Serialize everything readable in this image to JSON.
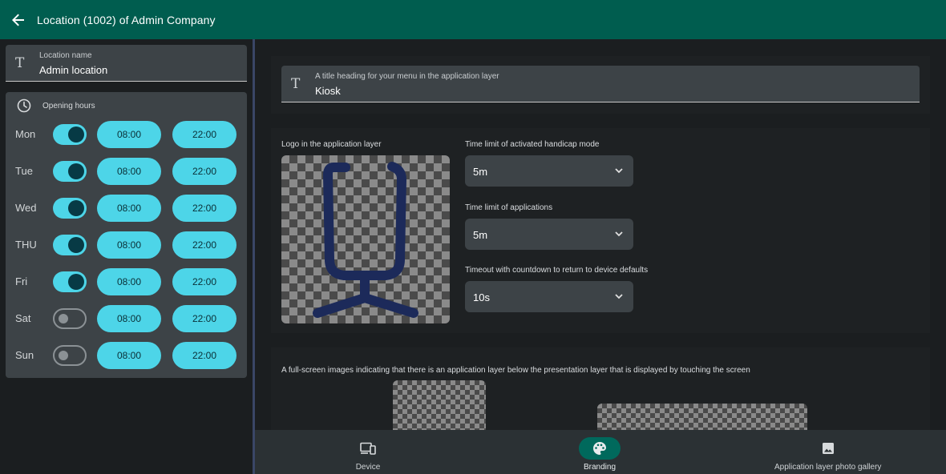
{
  "appbar": {
    "title": "Location (1002) of  Admin Company",
    "back_icon": "arrow-left-icon"
  },
  "location_name": {
    "label": "Location name",
    "value": "Admin location"
  },
  "opening_hours": {
    "label": "Opening hours",
    "days": [
      {
        "day": "Mon",
        "enabled": true,
        "start": "08:00",
        "end": "22:00"
      },
      {
        "day": "Tue",
        "enabled": true,
        "start": "08:00",
        "end": "22:00"
      },
      {
        "day": "Wed",
        "enabled": true,
        "start": "08:00",
        "end": "22:00"
      },
      {
        "day": "THU",
        "enabled": true,
        "start": "08:00",
        "end": "22:00"
      },
      {
        "day": "Fri",
        "enabled": true,
        "start": "08:00",
        "end": "22:00"
      },
      {
        "day": "Sat",
        "enabled": false,
        "start": "08:00",
        "end": "22:00"
      },
      {
        "day": "Sun",
        "enabled": false,
        "start": "08:00",
        "end": "22:00"
      }
    ]
  },
  "menu_title": {
    "label": "A title heading for your menu in the application layer",
    "value": "Kiosk"
  },
  "logo": {
    "label": "Logo in the application layer"
  },
  "handicap_limit": {
    "label": "Time limit of activated handicap mode",
    "value": "5m"
  },
  "app_limit": {
    "label": "Time limit of applications",
    "value": "5m"
  },
  "countdown_timeout": {
    "label": "Timeout with countdown to return to device defaults",
    "value": "10s"
  },
  "fullscreen_images": {
    "label": "A full-screen images indicating that there is an application layer below the presentation layer that is displayed by touching the screen"
  },
  "bottom_nav": [
    {
      "label": "Device",
      "icon": "devices-icon",
      "active": false
    },
    {
      "label": "Branding",
      "icon": "palette-icon",
      "active": true
    },
    {
      "label": "Application layer photo gallery",
      "icon": "image-icon",
      "active": false
    }
  ],
  "colors": {
    "appbar": "#005d4f",
    "accent": "#4dd5e8",
    "logo_stroke": "#1c2a5a",
    "nav_active": "#00695c"
  }
}
